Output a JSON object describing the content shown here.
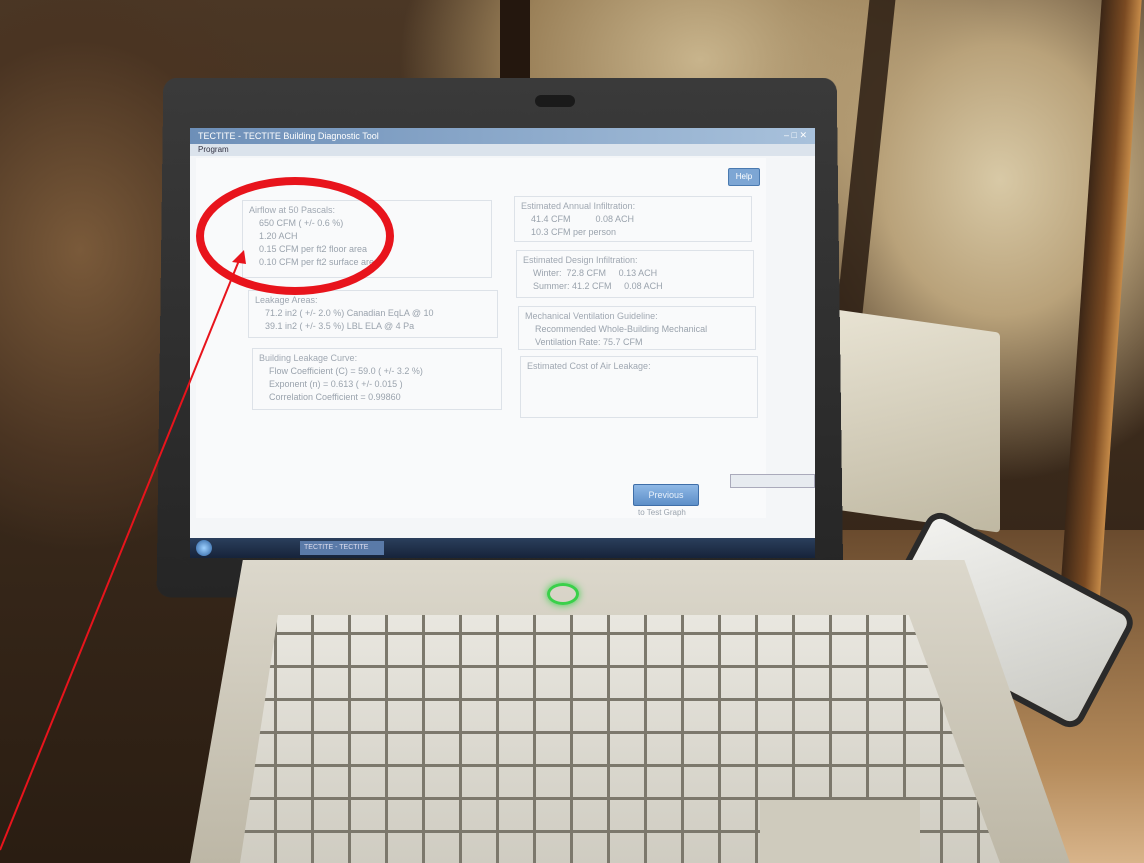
{
  "window": {
    "title": "TECTITE - TECTITE Building Diagnostic Tool",
    "menu": "Program"
  },
  "toolbar": {
    "help_label": "Help"
  },
  "results": {
    "airflow": {
      "heading": "Airflow at 50 Pascals:",
      "lines": [
        "650 CFM ( +/- 0.6 %)",
        "1.20 ACH",
        "0.15 CFM per ft2 floor area",
        "0.10 CFM per ft2 surface area"
      ]
    },
    "leakage_areas": {
      "heading": "Leakage Areas:",
      "lines": [
        "71.2 in2 ( +/- 2.0 %) Canadian EqLA @ 10",
        "39.1 in2 ( +/- 3.5 %) LBL ELA @ 4 Pa"
      ]
    },
    "leakage_curve": {
      "heading": "Building Leakage Curve:",
      "lines": [
        "Flow Coefficient (C) = 59.0 ( +/- 3.2 %)",
        "Exponent (n) = 0.613 ( +/- 0.015 )",
        "Correlation Coefficient = 0.99860"
      ]
    },
    "annual_infiltration": {
      "heading": "Estimated Annual Infiltration:",
      "lines": [
        "41.4 CFM",
        "0.08 ACH",
        "10.3 CFM per person"
      ]
    },
    "design_infiltration": {
      "heading": "Estimated Design Infiltration:",
      "lines": [
        "Winter:",
        "72.8 CFM",
        "0.13 ACH",
        "Summer:",
        "41.2 CFM",
        "0.08 ACH"
      ]
    },
    "ventilation": {
      "heading": "Mechanical Ventilation Guideline:",
      "lines": [
        "Recommended Whole-Building Mechanical",
        "Ventilation Rate: 75.7 CFM"
      ]
    },
    "cost": {
      "heading": "Estimated Cost of Air Leakage:"
    }
  },
  "nav": {
    "previous_label": "Previous",
    "test_graph_label": "to Test Graph"
  },
  "taskbar": {
    "task_label": "TECTITE - TECTITE"
  },
  "colors": {
    "annotation": "#e8141c",
    "power_led": "#3ad04a",
    "button": "#5d8fc8"
  }
}
